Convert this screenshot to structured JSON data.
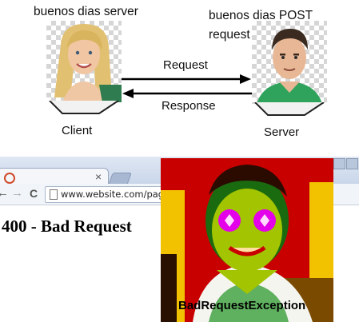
{
  "top_panel": {
    "client_caption": "buenos dias server",
    "server_caption_line1": "buenos dias POST",
    "server_caption_line2": "request",
    "request_label": "Request",
    "response_label": "Response",
    "client_label": "Client",
    "server_label": "Server"
  },
  "browser": {
    "tab_close": "×",
    "url": "www.website.com/pag",
    "error_heading": "400 - Bad Request",
    "back_icon": "←",
    "forward_icon": "→",
    "reload_icon": "C"
  },
  "meme_overlay": {
    "caption": "BadRequestException"
  },
  "colors": {
    "arrow": "#000000",
    "chrome": "#c9d6ea",
    "deepfry_red": "#c80000",
    "deepfry_yellow": "#f2c200",
    "deepfry_magenta": "#e400e8"
  }
}
